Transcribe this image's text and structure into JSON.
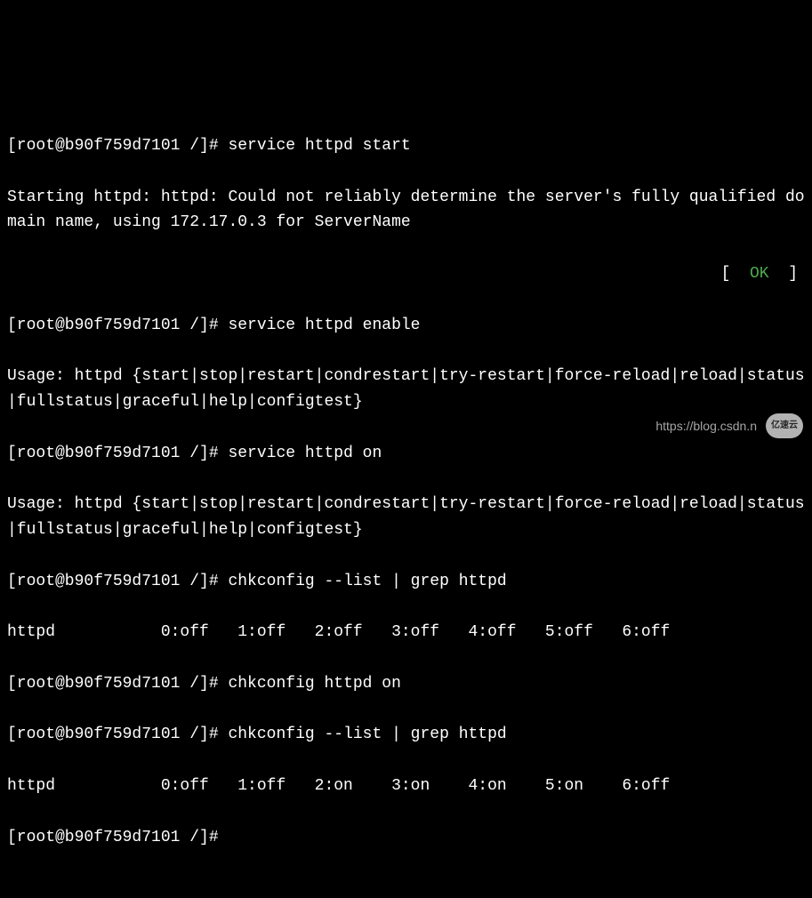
{
  "prompt": "[root@b90f759d7101 /]#",
  "lines": {
    "cmd1": "service httpd start",
    "out1": "Starting httpd: httpd: Could not reliably determine the server's fully qualified domain name, using 172.17.0.3 for ServerName",
    "status_open": "[  ",
    "status_ok": "OK",
    "status_close": "  ]",
    "cmd2": "service httpd enable",
    "usage": "Usage: httpd {start|stop|restart|condrestart|try-restart|force-reload|reload|status|fullstatus|graceful|help|configtest}",
    "cmd3": "service httpd on",
    "cmd4": "chkconfig --list | grep httpd",
    "runlevel_off": "httpd          \t0:off\t1:off\t2:off\t3:off\t4:off\t5:off\t6:off",
    "cmd5": "chkconfig httpd on",
    "cmd6": "chkconfig --list | grep httpd",
    "runlevel_on": "httpd          \t0:off\t1:off\t2:on\t3:on\t4:on\t5:on\t6:off"
  },
  "watermark": {
    "url": "https://blog.csdn.n",
    "logo": "亿速云"
  }
}
